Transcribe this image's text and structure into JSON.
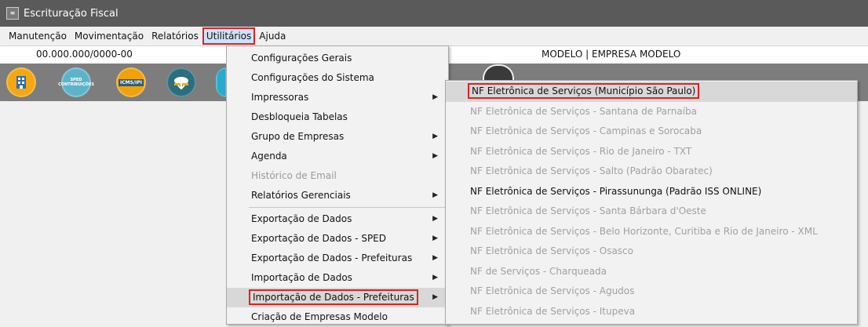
{
  "window": {
    "title": "Escrituração Fiscal"
  },
  "menubar": {
    "items": [
      {
        "label": "Manutenção"
      },
      {
        "label": "Movimentação"
      },
      {
        "label": "Relatórios"
      },
      {
        "label": "Utilitários"
      },
      {
        "label": "Ajuda"
      }
    ]
  },
  "infobar": {
    "cnpj": "00.000.000/0000-00",
    "company": "MODELO | EMPRESA MODELO"
  },
  "toolbar": {
    "buttons": [
      {
        "icon": "building-icon",
        "label": "",
        "color": "#f3a712"
      },
      {
        "icon": "sped-contribuicoes-icon",
        "label": "SPED CONTRIBUIÇÕES",
        "color": "#5fb3c9"
      },
      {
        "icon": "icms-ipi-icon",
        "label": "ICMS/IPI",
        "color": "#f0a20c"
      },
      {
        "icon": "cloud-download-icon",
        "label": "",
        "color": "#2c6e7e"
      },
      {
        "icon": "app-icon",
        "label": "",
        "color": "#2aa9c9"
      }
    ]
  },
  "utilitarios_menu": {
    "items": [
      {
        "label": "Configurações Gerais",
        "disabled": false,
        "submenu": false
      },
      {
        "label": "Configurações do Sistema",
        "disabled": false,
        "submenu": false
      },
      {
        "label": "Impressoras",
        "disabled": false,
        "submenu": true
      },
      {
        "label": "Desbloqueia Tabelas",
        "disabled": false,
        "submenu": false
      },
      {
        "label": "Grupo de Empresas",
        "disabled": false,
        "submenu": true
      },
      {
        "label": "Agenda",
        "disabled": false,
        "submenu": true
      },
      {
        "label": "Histórico de Email",
        "disabled": true,
        "submenu": false
      },
      {
        "label": "Relatórios Gerenciais",
        "disabled": false,
        "submenu": true
      },
      {
        "label": "Exportação de Dados",
        "disabled": false,
        "submenu": true
      },
      {
        "label": "Exportação de Dados - SPED",
        "disabled": false,
        "submenu": true
      },
      {
        "label": "Exportação de Dados - Prefeituras",
        "disabled": false,
        "submenu": true
      },
      {
        "label": "Importação de Dados",
        "disabled": false,
        "submenu": true
      },
      {
        "label": "Importação de Dados - Prefeituras",
        "disabled": false,
        "submenu": true
      },
      {
        "label": "Criação de Empresas Modelo",
        "disabled": false,
        "submenu": false
      }
    ]
  },
  "prefeituras_submenu": {
    "items": [
      {
        "label": "NF Eletrônica de Serviços (Município São Paulo)",
        "enabled": true
      },
      {
        "label": "NF Eletrônica de Serviços - Santana de Parnaíba",
        "enabled": false
      },
      {
        "label": "NF Eletrônica de Serviços - Campinas e Sorocaba",
        "enabled": false
      },
      {
        "label": "NF Eletrônica de Serviços - Rio de Janeiro - TXT",
        "enabled": false
      },
      {
        "label": "NF Eletrônica de Serviços - Salto (Padrão Obaratec)",
        "enabled": false
      },
      {
        "label": "NF Eletrônica de Serviços - Pirassununga (Padrão ISS ONLINE)",
        "enabled": true
      },
      {
        "label": "NF Eletrônica de Serviços - Santa Bárbara d'Oeste",
        "enabled": false
      },
      {
        "label": "NF Eletrônica de Serviços - Belo Horizonte, Curitiba e Rio de Janeiro - XML",
        "enabled": false
      },
      {
        "label": "NF Eletrônica de Serviços - Osasco",
        "enabled": false
      },
      {
        "label": "NF de Serviços - Charqueada",
        "enabled": false
      },
      {
        "label": "NF Eletrônica de Serviços - Agudos",
        "enabled": false
      },
      {
        "label": "NF Eletrônica de Serviços - Itupeva",
        "enabled": false
      }
    ]
  },
  "colors": {
    "highlight_box": "#dd2222",
    "titlebar": "#5a5a5a",
    "toolbar": "#7d7d7d"
  }
}
